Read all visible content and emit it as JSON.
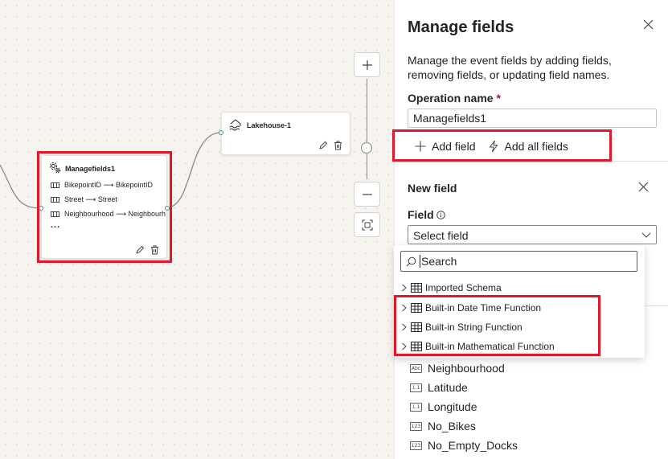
{
  "canvas": {
    "lakehouse_node": {
      "title": "Lakehouse-1"
    },
    "managefields_node": {
      "title": "Managefields1",
      "mappings": [
        {
          "from": "BikepointID",
          "to": "BikepointID"
        },
        {
          "from": "Street",
          "to": "Street"
        },
        {
          "from": "Neighbourhood",
          "to": "Neighbourhood"
        }
      ],
      "more": "..."
    },
    "zoom": {
      "in": "+",
      "out": "—"
    }
  },
  "panel": {
    "title": "Manage fields",
    "description": "Manage the event fields by adding fields, removing fields, or updating field names.",
    "operation_name_label": "Operation name",
    "required_marker": "*",
    "operation_name_value": "Managefields1",
    "add_field_label": "Add field",
    "add_all_fields_label": "Add all fields",
    "new_field": {
      "title": "New field",
      "field_label": "Field",
      "field_select_placeholder": "Select field"
    }
  },
  "dropdown": {
    "search_placeholder": "Search",
    "items": [
      {
        "label": "Imported Schema"
      },
      {
        "label": "Built-in Date Time Function"
      },
      {
        "label": "Built-in String Function"
      },
      {
        "label": "Built-in Mathematical Function"
      }
    ]
  },
  "schema_fields": [
    {
      "name": "Neighbourhood",
      "type": "Abc"
    },
    {
      "name": "Latitude",
      "type": "1.1"
    },
    {
      "name": "Longitude",
      "type": "1.1"
    },
    {
      "name": "No_Bikes",
      "type": "123"
    },
    {
      "name": "No_Empty_Docks",
      "type": "123"
    }
  ],
  "colors": {
    "highlight": "#e2182a",
    "port": "#4a8a8f",
    "canvas": "#f7f3ee"
  }
}
